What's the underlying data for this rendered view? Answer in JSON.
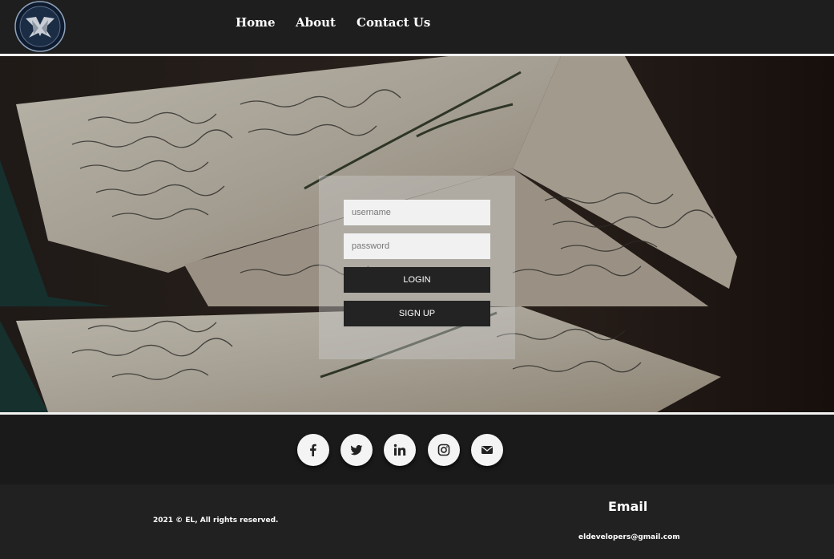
{
  "nav": {
    "home": "Home",
    "about": "About",
    "contact": "Contact Us"
  },
  "login": {
    "username_placeholder": "username",
    "password_placeholder": "password",
    "login_label": "LOGIN",
    "signup_label": "SIGN UP"
  },
  "social": [
    {
      "icon": "facebook-icon"
    },
    {
      "icon": "twitter-icon"
    },
    {
      "icon": "linkedin-icon"
    },
    {
      "icon": "instagram-icon"
    },
    {
      "icon": "envelope-icon"
    }
  ],
  "footer": {
    "copyright": "2021 © EL, All rights reserved.",
    "email_heading": "Email",
    "email_address": "eldevelopers@gmail.com"
  },
  "colors": {
    "header_bg": "#1e1e1e",
    "footer_bg": "#212121",
    "button_bg": "#232323",
    "text": "#ffffff"
  }
}
